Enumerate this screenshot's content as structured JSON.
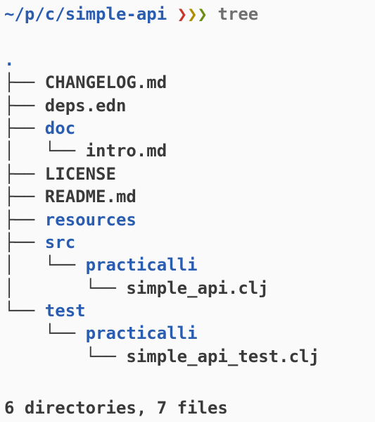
{
  "prompt": {
    "path": "~/p/c/simple-api ",
    "chevrons": {
      "red": "❯",
      "yellow": "❯",
      "green": "❯"
    },
    "command": " tree"
  },
  "tree": {
    "dot": ".",
    "lines": [
      {
        "branch": "├── ",
        "name": "CHANGELOG.md",
        "is_dir": false
      },
      {
        "branch": "├── ",
        "name": "deps.edn",
        "is_dir": false
      },
      {
        "branch": "├── ",
        "name": "doc",
        "is_dir": true
      },
      {
        "branch": "│   └── ",
        "name": "intro.md",
        "is_dir": false
      },
      {
        "branch": "├── ",
        "name": "LICENSE",
        "is_dir": false
      },
      {
        "branch": "├── ",
        "name": "README.md",
        "is_dir": false
      },
      {
        "branch": "├── ",
        "name": "resources",
        "is_dir": true
      },
      {
        "branch": "├── ",
        "name": "src",
        "is_dir": true
      },
      {
        "branch": "│   └── ",
        "name": "practicalli",
        "is_dir": true
      },
      {
        "branch": "│       └── ",
        "name": "simple_api.clj",
        "is_dir": false
      },
      {
        "branch": "└── ",
        "name": "test",
        "is_dir": true
      },
      {
        "branch": "    └── ",
        "name": "practicalli",
        "is_dir": true
      },
      {
        "branch": "        └── ",
        "name": "simple_api_test.clj",
        "is_dir": false
      }
    ]
  },
  "summary": "6 directories, 7 files"
}
